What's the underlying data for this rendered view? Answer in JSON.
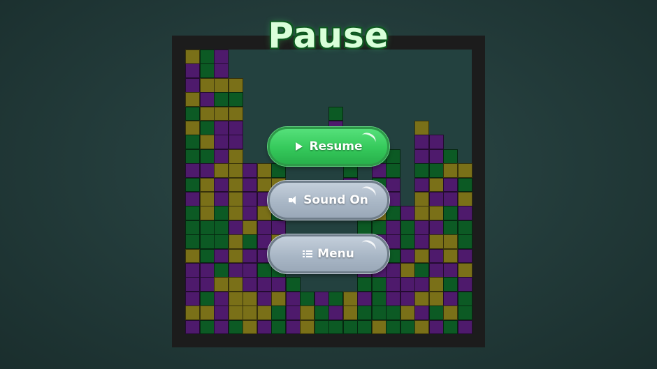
{
  "title": "Pause",
  "buttons": {
    "resume": {
      "label": "Resume",
      "icon": "play-icon"
    },
    "sound": {
      "label": "Sound On",
      "icon": "speaker-icon"
    },
    "menu": {
      "label": "Menu",
      "icon": "list-icon"
    }
  },
  "colors": {
    "background": "#223a39",
    "frame": "#1c1c1c",
    "board": "#23413f",
    "olive": "#7a7018",
    "green": "#0c5a24",
    "purple": "#4e1a6c",
    "button_green": "#35c95b",
    "button_grey": "#a9b7c6"
  },
  "board": {
    "columns": 20,
    "rows": 20,
    "palette": {
      "O": "#7a7018",
      "G": "#0c5a24",
      "P": "#4e1a6c"
    },
    "cells": [
      "OGP.................",
      "PGP.................",
      "POOO................",
      "OPGG................",
      "GOOO......G.........",
      "OGPP......P.....O...",
      "GOPP.......P....PP..",
      "GGPO.......P.GG.PPG.",
      "PPOOPOG....G.PG.GGOO",
      "GOPOPOO....P.GP.POPG",
      "POPOPPG.....GOP.OPPO",
      "GOGOPOG.....POGPOOGP",
      "GGGPOPP.....GGPGPPGG",
      "GGGOGPO.....PPPGPOOG",
      "OGPOPPO.....GGGPOPOP",
      "PPGPPGG.....PPPOGPPO",
      "PPOOPPPG....GGPPPOGP",
      "PGPOOPOPGPGOPGPPOOPG",
      "OOPOOOGPOGPOGGGOPGOG",
      "PGPGOPGPOGGGGOGGOPGP"
    ]
  }
}
